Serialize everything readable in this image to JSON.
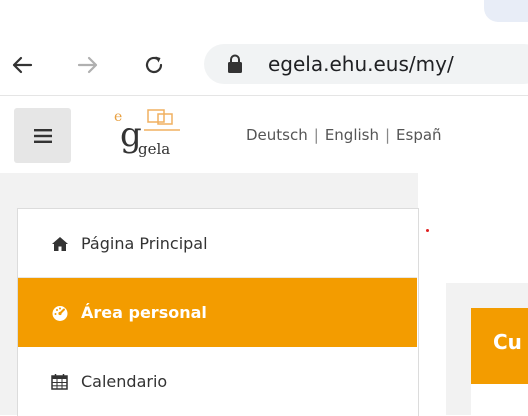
{
  "browser": {
    "url": "egela.ehu.eus/my/",
    "icons": [
      "back-arrow-icon",
      "forward-arrow-icon",
      "reload-icon",
      "lock-icon"
    ]
  },
  "header": {
    "logo_text": "gela",
    "languages": [
      "Deutsch",
      "English",
      "Españ"
    ]
  },
  "sidebar": {
    "items": [
      {
        "label": "Página Principal",
        "icon": "home-icon",
        "active": false
      },
      {
        "label": "Área personal",
        "icon": "dashboard-icon",
        "active": true
      },
      {
        "label": "Calendario",
        "icon": "calendar-icon",
        "active": false
      }
    ]
  },
  "main": {
    "course_header": "Cu"
  },
  "colors": {
    "accent": "#f39c00",
    "panel_bg": "#f2f2f2"
  }
}
